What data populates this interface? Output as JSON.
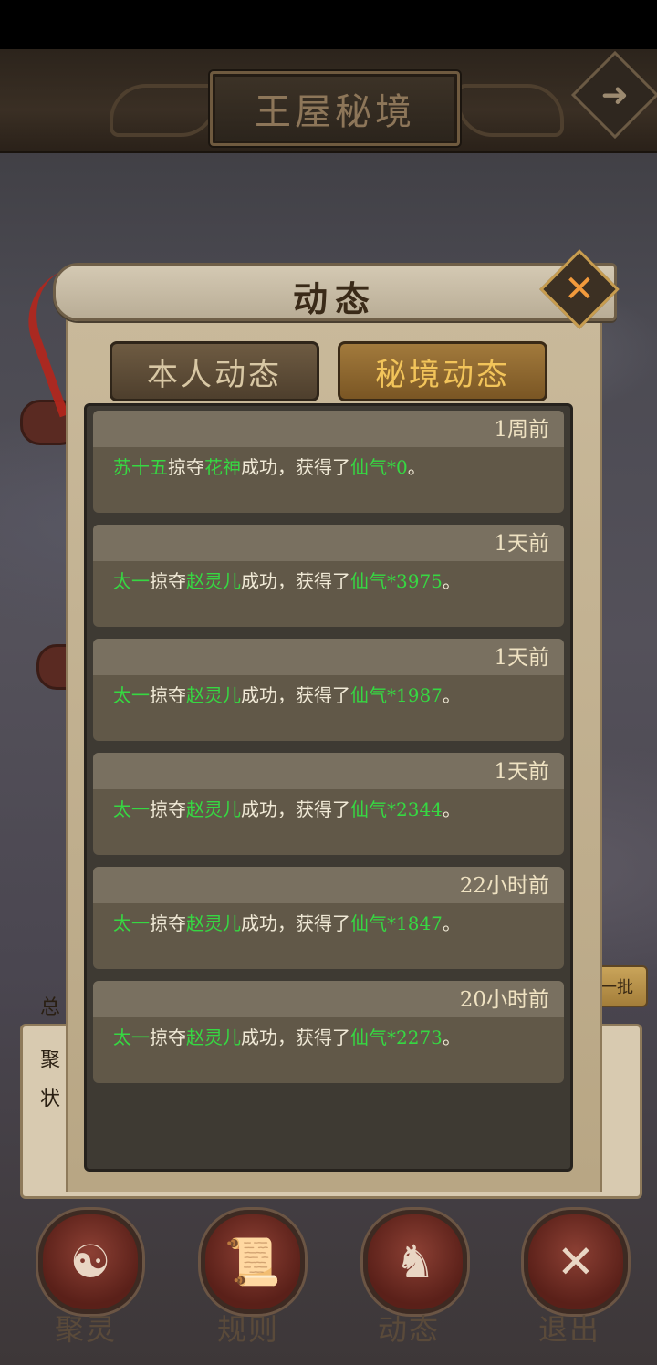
{
  "header": {
    "title": "王屋秘境",
    "next_icon": "arrow-right-icon"
  },
  "dialog": {
    "title": "动态",
    "close_icon": "close-x-icon",
    "tabs": [
      {
        "label": "本人动态",
        "active": false
      },
      {
        "label": "秘境动态",
        "active": true
      }
    ],
    "entries": [
      {
        "time": "1周前",
        "player": "苏十五",
        "action": "掠夺",
        "target": "花神",
        "result": "成功，获得了",
        "item": "仙气",
        "amount": "*0",
        "end": "。"
      },
      {
        "time": "1天前",
        "player": "太一",
        "action": "掠夺",
        "target": "赵灵儿",
        "result": "成功，获得了",
        "item": "仙气",
        "amount": "*3975",
        "end": "。"
      },
      {
        "time": "1天前",
        "player": "太一",
        "action": "掠夺",
        "target": "赵灵儿",
        "result": "成功，获得了",
        "item": "仙气",
        "amount": "*1987",
        "end": "。"
      },
      {
        "time": "1天前",
        "player": "太一",
        "action": "掠夺",
        "target": "赵灵儿",
        "result": "成功，获得了",
        "item": "仙气",
        "amount": "*2344",
        "end": "。"
      },
      {
        "time": "22小时前",
        "player": "太一",
        "action": "掠夺",
        "target": "赵灵儿",
        "result": "成功，获得了",
        "item": "仙气",
        "amount": "*1847",
        "end": "。"
      },
      {
        "time": "20小时前",
        "player": "太一",
        "action": "掠夺",
        "target": "赵灵儿",
        "result": "成功，获得了",
        "item": "仙气",
        "amount": "*2273",
        "end": "。"
      }
    ],
    "colors": {
      "highlight": "#36d842",
      "active_tab_text": "#f2c45a"
    }
  },
  "background": {
    "label_total": "总",
    "label_ju": "聚",
    "label_zhuang": "状",
    "batch_button": "一批"
  },
  "bottom_nav": [
    {
      "label": "聚灵",
      "icon": "yin-yang-icon"
    },
    {
      "label": "规则",
      "icon": "scroll-icon"
    },
    {
      "label": "动态",
      "icon": "figure-icon"
    },
    {
      "label": "退出",
      "icon": "exit-x-icon"
    }
  ]
}
